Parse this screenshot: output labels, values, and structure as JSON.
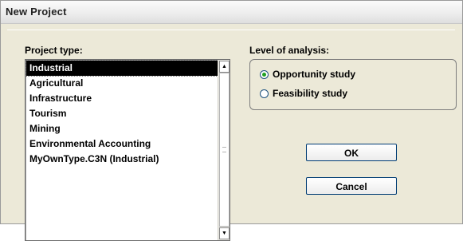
{
  "window": {
    "title": "New Project"
  },
  "project_type": {
    "label": "Project type:",
    "items": [
      {
        "label": "Industrial",
        "selected": true
      },
      {
        "label": "Agricultural",
        "selected": false
      },
      {
        "label": "Infrastructure",
        "selected": false
      },
      {
        "label": "Tourism",
        "selected": false
      },
      {
        "label": "Mining",
        "selected": false
      },
      {
        "label": "Environmental Accounting",
        "selected": false
      },
      {
        "label": "MyOwnType.C3N (Industrial)",
        "selected": false
      }
    ]
  },
  "analysis": {
    "label": "Level of analysis:",
    "options": [
      {
        "label": "Opportunity study",
        "checked": true
      },
      {
        "label": "Feasibility study",
        "checked": false
      }
    ]
  },
  "buttons": {
    "ok": "OK",
    "cancel": "Cancel"
  }
}
